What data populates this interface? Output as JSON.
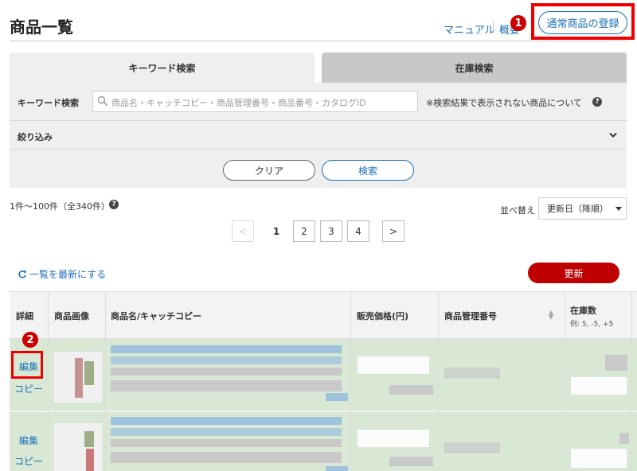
{
  "header": {
    "title": "商品一覧",
    "manual_link": "マニュアル",
    "overview_link": "概要",
    "register_button": "通常商品の登録",
    "badge_1": "1",
    "badge_2": "2"
  },
  "tabs": [
    {
      "label": "キーワード検索",
      "active": true
    },
    {
      "label": "在庫検索",
      "active": false
    }
  ],
  "search": {
    "label": "キーワード検索",
    "placeholder": "商品名・キャッチコピー・商品管理番号・商品番号・カタログID",
    "note": "※検索結果で表示されない商品について",
    "filter_label": "絞り込み",
    "clear_button": "クリア",
    "search_button": "検索"
  },
  "results": {
    "count_text": "1件〜100件（全340件）",
    "sort_label": "並べ替え",
    "sort_value": "更新日（降順）"
  },
  "pagination": {
    "prev": "<",
    "pages": [
      "1",
      "2",
      "3",
      "4"
    ],
    "current": "1",
    "next": ">"
  },
  "actions": {
    "refresh_link": "一覧を最新にする",
    "update_button": "更新"
  },
  "table": {
    "columns": [
      "詳細",
      "商品画像",
      "商品名/キャッチコピー",
      "販売価格(円)",
      "商品管理番号",
      "在庫数"
    ],
    "stock_hint": "例: 5, -5, +5",
    "rows": [
      {
        "edit": "編集",
        "copy": "コピー"
      },
      {
        "edit": "編集",
        "copy": "コピー"
      }
    ]
  },
  "colors": {
    "accent_blue": "#1a6fb8",
    "update_red": "#bf0000",
    "highlight_red": "#ee0000",
    "row_green": "#d8e8d4"
  }
}
